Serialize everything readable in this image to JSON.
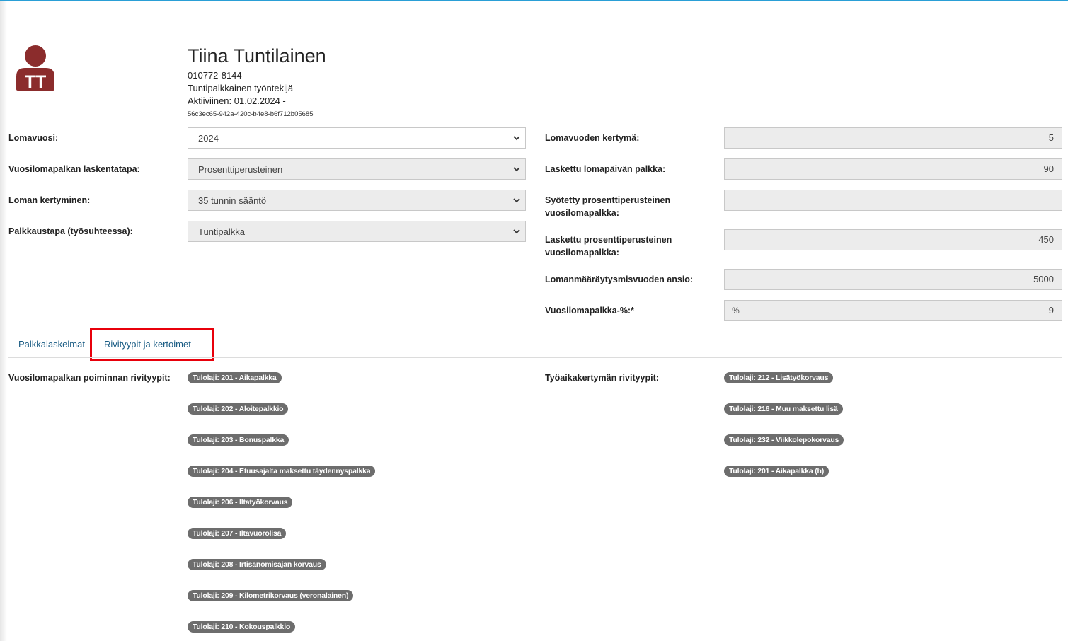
{
  "employee": {
    "initials": "TT",
    "name": "Tiina Tuntilainen",
    "id_number": "010772-8144",
    "role": "Tuntipalkkainen työntekijä",
    "active": "Aktiiviinen: 01.02.2024 -",
    "uuid": "56c3ec65-942a-420c-b4e8-b6f712b05685",
    "avatar_color": "#8b2c2c"
  },
  "left_form": {
    "year": {
      "label": "Lomavuosi:",
      "value": "2024"
    },
    "calc_method": {
      "label": "Vuosilomapalkan laskentatapa:",
      "value": "Prosenttiperusteinen"
    },
    "accrual": {
      "label": "Loman kertyminen:",
      "value": "35 tunnin sääntö"
    },
    "pay_type": {
      "label": "Palkkaustapa (työsuhteessa):",
      "value": "Tuntipalkka"
    }
  },
  "right_form": {
    "accumulation": {
      "label": "Lomavuoden kertymä:",
      "value": "5"
    },
    "day_pay": {
      "label": "Laskettu lomapäivän palkka:",
      "value": "90"
    },
    "entered_pct_pay": {
      "label_line1": "Syötetty prosenttiperusteinen",
      "label_line2": "vuosilomapalkka:",
      "value": ""
    },
    "calculated_pct_pay": {
      "label_line1": "Laskettu prosenttiperusteinen",
      "label_line2": "vuosilomapalkka:",
      "value": "450"
    },
    "earnings": {
      "label": "Lomanmääräytysmisvuoden ansio:",
      "value": "5000"
    },
    "pct": {
      "label": "Vuosilomapalkka-%:*",
      "unit": "%",
      "value": "9"
    }
  },
  "tabs": [
    {
      "label": "Palkkalaskelmat"
    },
    {
      "label": "Rivityypit ja kertoimet"
    }
  ],
  "highlight_color": "#e8000b",
  "row_types": {
    "left_label": "Vuosilomapalkan poiminnan rivityypit:",
    "left_items": [
      "Tulolaji: 201 - Aikapalkka",
      "Tulolaji: 202 - Aloitepalkkio",
      "Tulolaji: 203 - Bonuspalkka",
      "Tulolaji: 204 - Etuusajalta maksettu täydennyspalkka",
      "Tulolaji: 206 - Iltatyökorvaus",
      "Tulolaji: 207 - Iltavuorolisä",
      "Tulolaji: 208 - Irtisanomisajan korvaus",
      "Tulolaji: 209 - Kilometrikorvaus (veronalainen)",
      "Tulolaji: 210 - Kokouspalkkio"
    ],
    "right_label": "Työaikakertymän rivityypit:",
    "right_items": [
      "Tulolaji: 212 - Lisätyökorvaus",
      "Tulolaji: 216 - Muu maksettu lisä",
      "Tulolaji: 232 - Viikkolepokorvaus",
      "Tulolaji: 201 - Aikapalkka (h)"
    ]
  }
}
